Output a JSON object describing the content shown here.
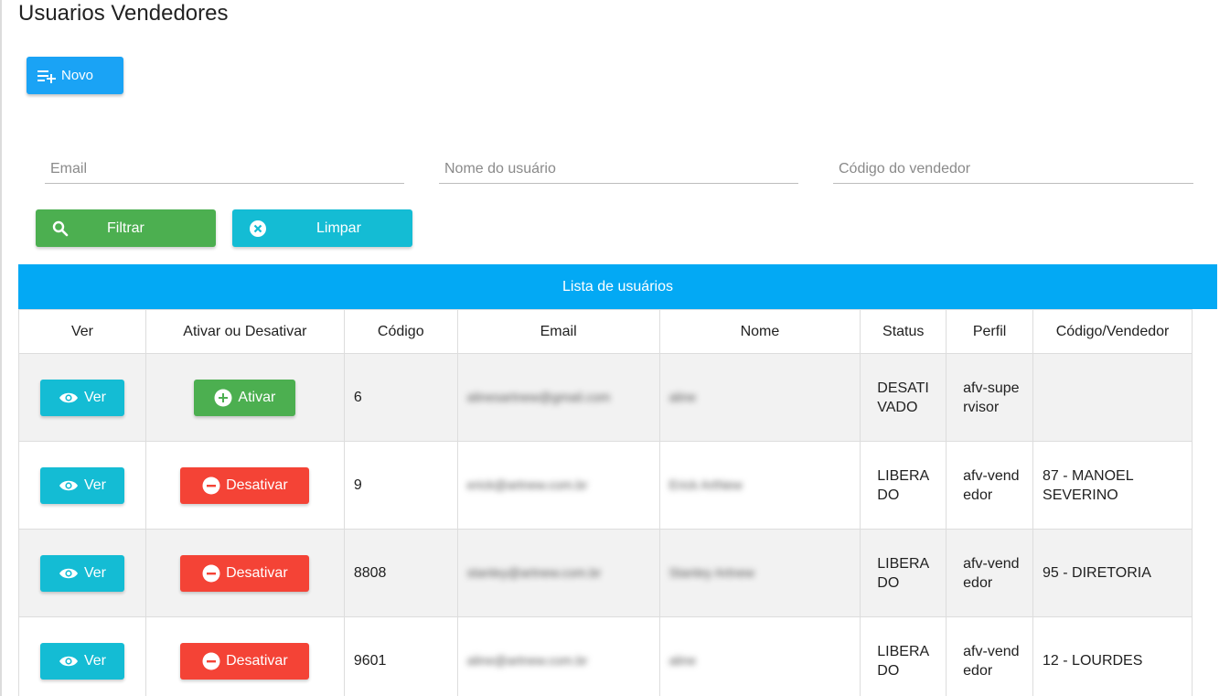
{
  "page": {
    "title": "Usuarios Vendedores"
  },
  "toolbar": {
    "new_label": "Novo"
  },
  "filters": {
    "email_placeholder": "Email",
    "name_placeholder": "Nome do usuário",
    "code_placeholder": "Código do vendedor",
    "filter_label": "Filtrar",
    "clear_label": "Limpar"
  },
  "table": {
    "banner": "Lista de usuários",
    "headers": [
      "Ver",
      "Ativar ou Desativar",
      "Código",
      "Email",
      "Nome",
      "Status",
      "Perfil",
      "Código/Vendedor"
    ],
    "rows": [
      {
        "ver": "Ver",
        "action": "Ativar",
        "action_type": "activate",
        "code": "6",
        "email": "alinesartnew@gmail.com",
        "name": "aline",
        "status": "DESATIVADO",
        "perfil": "afv-supervisor",
        "vendedor": ""
      },
      {
        "ver": "Ver",
        "action": "Desativar",
        "action_type": "deactivate",
        "code": "9",
        "email": "erick@artnew.com.br",
        "name": "Erick ArtNew",
        "status": "LIBERADO",
        "perfil": "afv-vendedor",
        "vendedor": "87 - MANOEL SEVERINO"
      },
      {
        "ver": "Ver",
        "action": "Desativar",
        "action_type": "deactivate",
        "code": "8808",
        "email": "stanley@artnew.com.br",
        "name": "Stanley Artnew",
        "status": "LIBERADO",
        "perfil": "afv-vendedor",
        "vendedor": "95 - DIRETORIA"
      },
      {
        "ver": "Ver",
        "action": "Desativar",
        "action_type": "deactivate",
        "code": "9601",
        "email": "aline@artnew.com.br",
        "name": "aline",
        "status": "LIBERADO",
        "perfil": "afv-vendedor",
        "vendedor": "12 - LOURDES"
      }
    ]
  },
  "colors": {
    "primary": "#03a9f4",
    "success": "#4caf50",
    "info": "#14bcd4",
    "danger": "#f44336"
  }
}
